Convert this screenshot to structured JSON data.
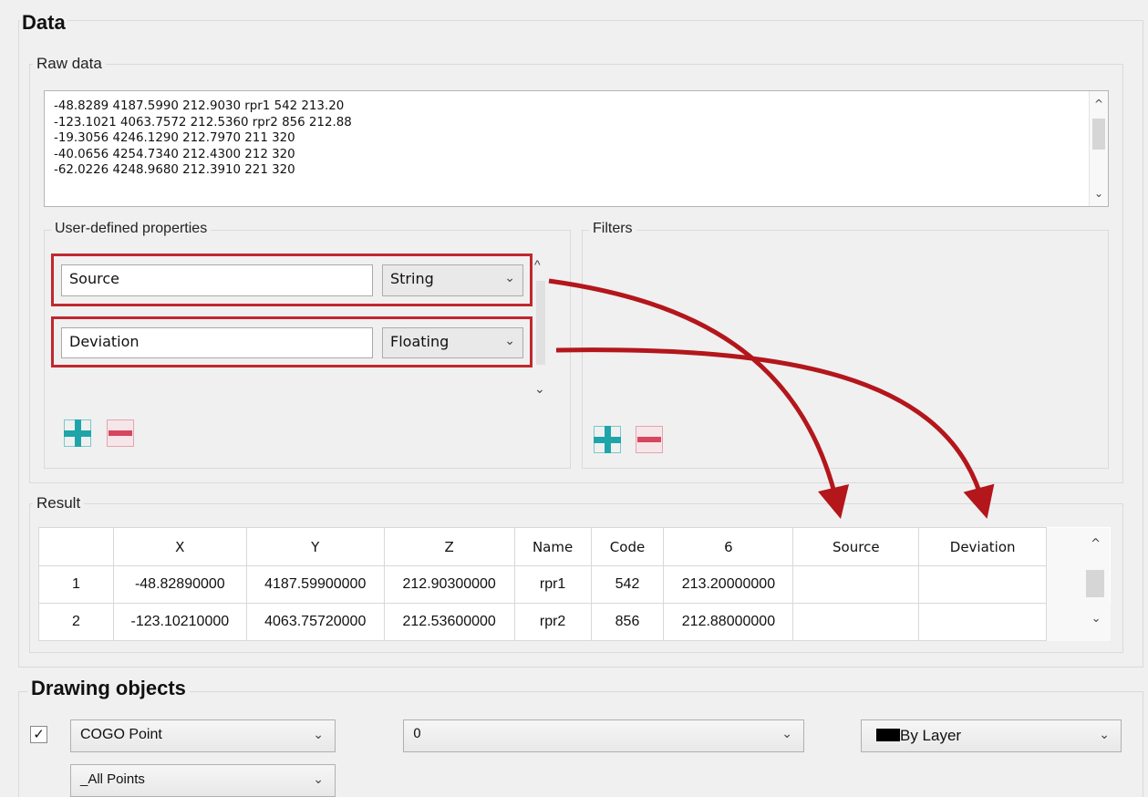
{
  "data_section": {
    "title": "Data",
    "raw_data": {
      "label": "Raw data",
      "lines": [
        "-48.8289 4187.5990 212.9030 rpr1 542 213.20",
        "-123.1021 4063.7572 212.5360 rpr2 856 212.88",
        "-19.3056 4246.1290 212.7970 211 320",
        "-40.0656 4254.7340 212.4300 212 320",
        "-62.0226 4248.9680 212.3910 221 320"
      ]
    },
    "user_props": {
      "label": "User-defined properties",
      "rows": [
        {
          "name": "Source",
          "type": "String"
        },
        {
          "name": "Deviation",
          "type": "Floating"
        }
      ]
    },
    "filters": {
      "label": "Filters"
    },
    "result": {
      "label": "Result",
      "columns": [
        "",
        "X",
        "Y",
        "Z",
        "Name",
        "Code",
        "6",
        "Source",
        "Deviation"
      ],
      "rows": [
        [
          "1",
          "-48.82890000",
          "4187.59900000",
          "212.90300000",
          "rpr1",
          "542",
          "213.20000000",
          "",
          ""
        ],
        [
          "2",
          "-123.10210000",
          "4063.75720000",
          "212.53600000",
          "rpr2",
          "856",
          "212.88000000",
          "",
          ""
        ]
      ]
    }
  },
  "drawing_objects": {
    "title": "Drawing objects",
    "enabled": true,
    "object_type": "COGO Point",
    "point_group": "_All Points",
    "layer": "0",
    "color": "By Layer",
    "color_swatch": "#000000"
  },
  "icons": {
    "add": "plus-icon",
    "remove": "minus-icon",
    "chevron": "chevron-down-icon",
    "check": "check-icon"
  },
  "colors": {
    "highlight": "#c0282f",
    "arrow": "#b3161b",
    "add_icon": "#1fa5a9",
    "remove_icon": "#d8455e"
  }
}
